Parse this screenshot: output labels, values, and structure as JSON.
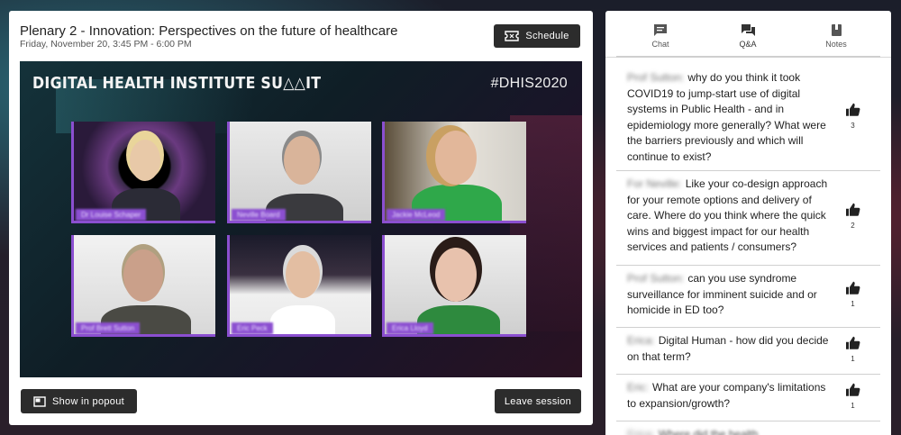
{
  "session": {
    "title": "Plenary 2 - Innovation: Perspectives on the future of healthcare",
    "datetime": "Friday, November 20, 3:45 PM - 6:00 PM",
    "schedule_label": "Schedule",
    "popout_label": "Show in popout",
    "leave_label": "Leave session"
  },
  "video": {
    "banner": "DIGITAL HEALTH INSTITUTE SU△△IT",
    "hashtag": "#DHIS2020",
    "participants": [
      {
        "name": "Dr Louise Schaper"
      },
      {
        "name": "Neville Board"
      },
      {
        "name": "Jackie McLeod"
      },
      {
        "name": "Prof Brett Sutton"
      },
      {
        "name": "Eric Peck"
      },
      {
        "name": "Erica Lloyd"
      }
    ]
  },
  "tabs": [
    {
      "label": "Chat",
      "icon": "chat-icon"
    },
    {
      "label": "Q&A",
      "icon": "qa-icon"
    },
    {
      "label": "Notes",
      "icon": "notes-icon"
    }
  ],
  "questions": [
    {
      "author": "Prof Sutton:",
      "text": "why do you think it took COVID19 to jump-start use of digital systems in Public Health - and in epidemiology more generally? What were the barriers previously and which will continue to exist?",
      "likes": "3"
    },
    {
      "author": "For Neville:",
      "text": "Like your co-design approach for your remote options and delivery of care. Where do you think where the quick wins and biggest impact for our health services and patients / consumers?",
      "likes": "2"
    },
    {
      "author": "Prof Sutton:",
      "text": "can you use syndrome surveillance for imminent suicide and or homicide in ED too?",
      "likes": "1"
    },
    {
      "author": "Erica:",
      "text": "Digital Human - how did you decide on that term?",
      "likes": "1"
    },
    {
      "author": "Eric:",
      "text": "What are your company's limitations to expansion/growth?",
      "likes": "1"
    },
    {
      "author": "Erica:",
      "text": "Where did the health",
      "likes": ""
    }
  ],
  "colors": {
    "accent_purple": "#8b4fd0",
    "button_dark": "#2c2c2c"
  }
}
